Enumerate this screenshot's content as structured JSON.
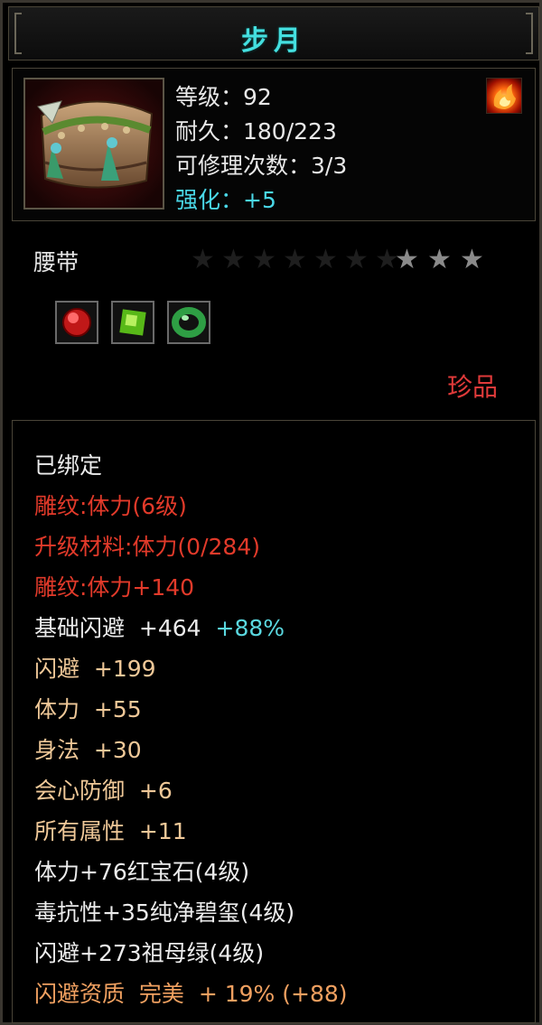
{
  "title": "步月",
  "item": {
    "icon": "belt-item-icon",
    "stats": [
      {
        "label": "等级：92"
      },
      {
        "label": "耐久：180/223"
      },
      {
        "label": "可修理次数：3/3"
      },
      {
        "label": "强化：+5"
      }
    ],
    "element_icon": "fire-icon"
  },
  "type": "腰带",
  "stars": {
    "total": 10,
    "lit": 3
  },
  "gems": [
    {
      "name": "ruby-gem-icon",
      "color": "#d02020"
    },
    {
      "name": "green-gem-icon",
      "color": "#60c020"
    },
    {
      "name": "jade-ring-icon",
      "color": "#30a040"
    }
  ],
  "rarity": "珍品",
  "attributes": {
    "bound": "已绑定",
    "engrave1": "雕纹:体力(6级)",
    "upgrade": "升级材料:体力(0/284)",
    "engrave2": "雕纹:体力+140",
    "base_dodge": "基础闪避",
    "base_dodge_val": "+464",
    "base_dodge_pct": "+88%",
    "dodge": "闪避",
    "dodge_val": "+199",
    "stamina": "体力",
    "stamina_val": "+55",
    "agility": "身法",
    "agility_val": "+30",
    "crit_def": "会心防御",
    "crit_def_val": "+6",
    "all_attr": "所有属性",
    "all_attr_val": "+11",
    "gem1": "体力+76红宝石(4级)",
    "gem2": "毒抗性+35纯净碧玺(4级)",
    "gem3": "闪避+273祖母绿(4级)",
    "quality": "闪避资质",
    "quality_val": "完美",
    "quality_pct": "+ 19% (+88)"
  }
}
